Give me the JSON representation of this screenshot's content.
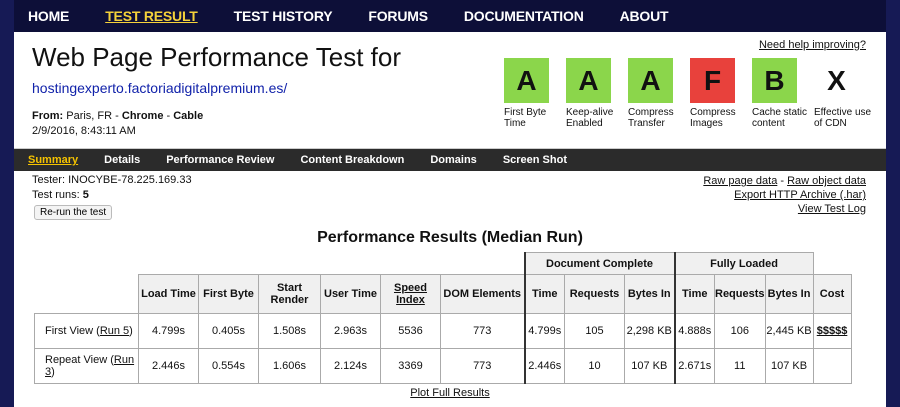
{
  "nav": {
    "items": [
      "HOME",
      "TEST RESULT",
      "TEST HISTORY",
      "FORUMS",
      "DOCUMENTATION",
      "ABOUT"
    ],
    "active": "TEST RESULT"
  },
  "header": {
    "title": "Web Page Performance Test for",
    "url": "hostingexperto.factoriadigitalpremium.es/",
    "from_label": "From:",
    "from_location": "Paris, FR",
    "separator": "-",
    "browser": "Chrome",
    "connection": "Cable",
    "date": "2/9/2016, 8:43:11 AM",
    "help_link": "Need help improving?"
  },
  "grades": [
    {
      "grade": "A",
      "label": "First Byte Time",
      "color": "#8bd64b"
    },
    {
      "grade": "A",
      "label": "Keep-alive Enabled",
      "color": "#8bd64b"
    },
    {
      "grade": "A",
      "label": "Compress Transfer",
      "color": "#8bd64b"
    },
    {
      "grade": "F",
      "label": "Compress Images",
      "color": "#e8413c"
    },
    {
      "grade": "B",
      "label": "Cache static content",
      "color": "#8bd64b"
    },
    {
      "grade": "X",
      "label": "Effective use of CDN",
      "color": "#ffffff"
    }
  ],
  "subnav": {
    "items": [
      "Summary",
      "Details",
      "Performance Review",
      "Content Breakdown",
      "Domains",
      "Screen Shot"
    ],
    "active": "Summary"
  },
  "meta": {
    "tester": "Tester: INOCYBE-78.225.169.33",
    "runs_label": "Test runs:",
    "runs_value": "5",
    "rerun_button": "Re-run the test",
    "links": [
      "Raw page data",
      "Raw object data",
      "Export HTTP Archive (.har)",
      "View Test Log"
    ]
  },
  "results": {
    "title": "Performance Results (Median Run)",
    "group_headers": {
      "document_complete": "Document Complete",
      "fully_loaded": "Fully Loaded"
    },
    "columns": [
      "Load Time",
      "First Byte",
      "Start Render",
      "User Time",
      "Speed Index",
      "DOM Elements",
      "Time",
      "Requests",
      "Bytes In",
      "Time",
      "Requests",
      "Bytes In",
      "Cost"
    ],
    "rows": [
      {
        "label": "First View (",
        "run_link": "Run 5",
        "label_end": ")",
        "cells": [
          "4.799s",
          "0.405s",
          "1.508s",
          "2.963s",
          "5536",
          "773",
          "4.799s",
          "105",
          "2,298 KB",
          "4.888s",
          "106",
          "2,445 KB"
        ],
        "cost": "$$$$$"
      },
      {
        "label": "Repeat View (",
        "run_link": "Run 3",
        "label_end": ")",
        "cells": [
          "2.446s",
          "0.554s",
          "1.606s",
          "2.124s",
          "3369",
          "773",
          "2.446s",
          "10",
          "107 KB",
          "2.671s",
          "11",
          "107 KB"
        ],
        "cost": ""
      }
    ],
    "plot_link": "Plot Full Results"
  }
}
